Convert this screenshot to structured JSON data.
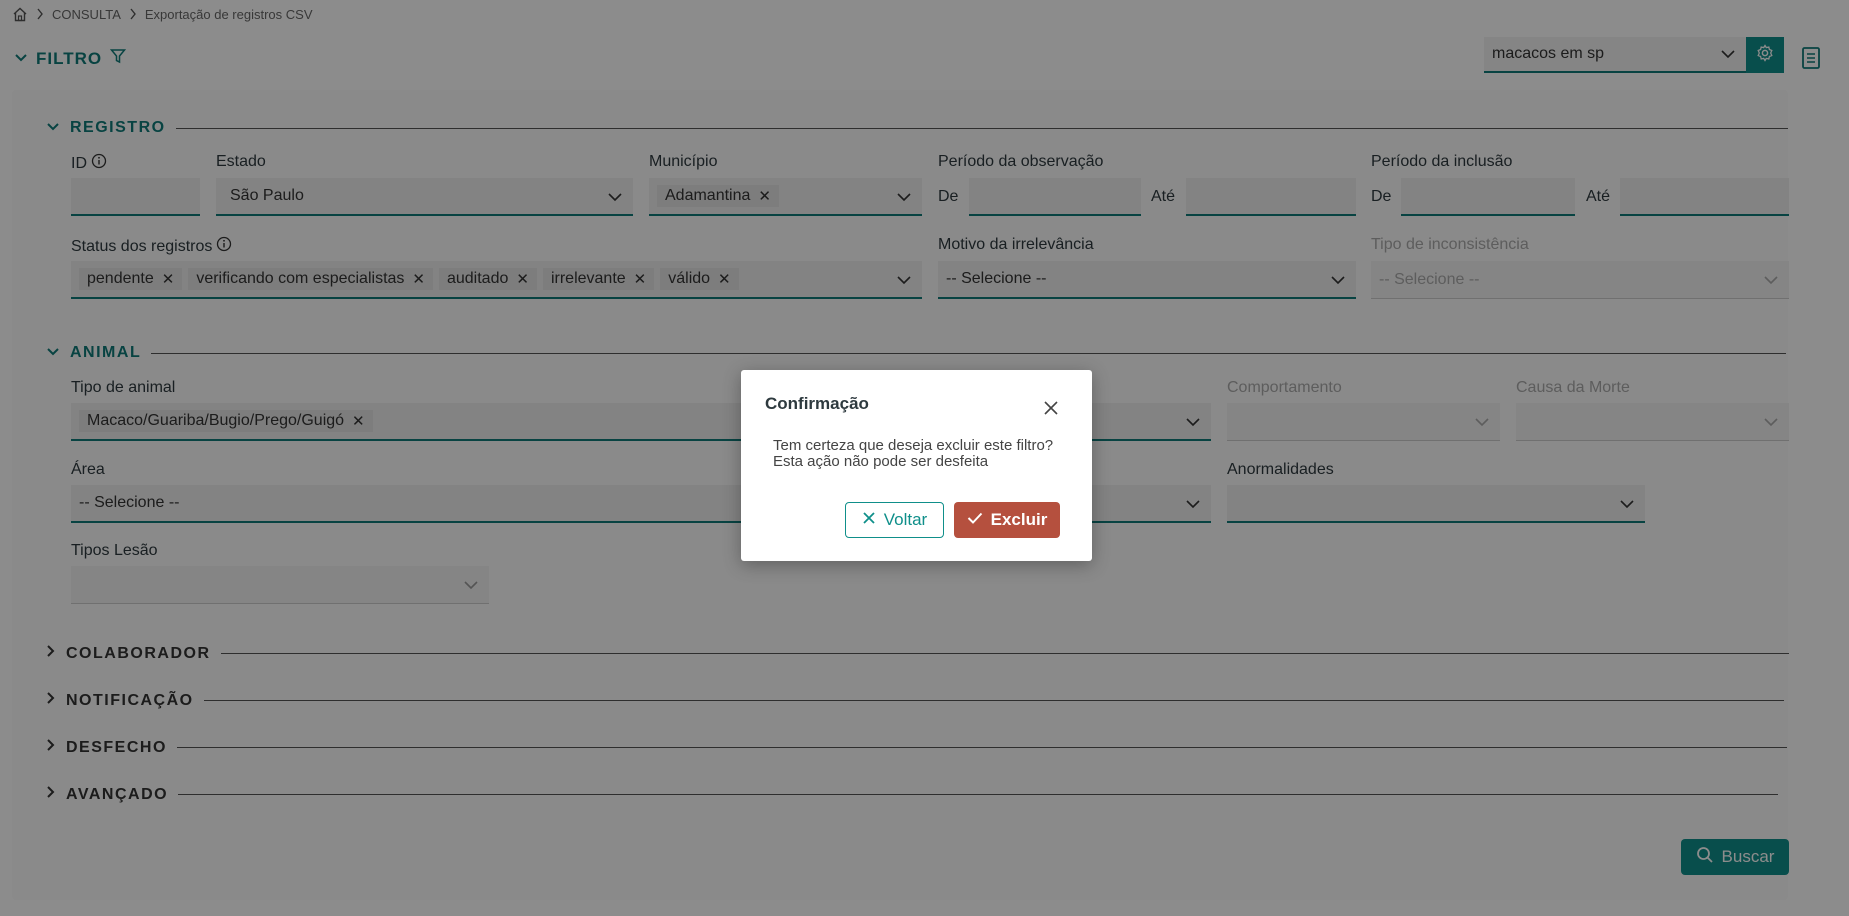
{
  "breadcrumb": {
    "items": [
      "CONSULTA",
      "Exportação de registros CSV"
    ]
  },
  "filter": {
    "title": "FILTRO"
  },
  "saved_filter": {
    "value": "macacos em sp"
  },
  "sections": {
    "registro": "REGISTRO",
    "animal": "ANIMAL",
    "colaborador": "COLABORADOR",
    "notificacao": "NOTIFICAÇÃO",
    "desfecho": "DESFECHO",
    "avancado": "AVANÇADO"
  },
  "registro": {
    "id_label": "ID",
    "estado_label": "Estado",
    "estado_value": "São Paulo",
    "municipio_label": "Município",
    "municipio_chip": "Adamantina",
    "obs_label": "Período da observação",
    "incl_label": "Período da inclusão",
    "de": "De",
    "ate": "Até",
    "status_label": "Status dos registros",
    "status_chips": [
      "pendente",
      "verificando com especialistas",
      "auditado",
      "irrelevante",
      "válido"
    ],
    "motivo_label": "Motivo da irrelevância",
    "motivo_value": "-- Selecione --",
    "tipo_incons_label": "Tipo de inconsistência",
    "tipo_incons_value": "-- Selecione --"
  },
  "animal": {
    "tipo_label": "Tipo de animal",
    "tipo_chip": "Macaco/Guariba/Bugio/Prego/Guigó",
    "comportamento_label": "Comportamento",
    "causa_label": "Causa da Morte",
    "area_label": "Área",
    "area_value": "-- Selecione --",
    "anormalidades_label": "Anormalidades",
    "lesao_label": "Tipos Lesão"
  },
  "search_button": "Buscar",
  "modal": {
    "title": "Confirmação",
    "message": "Tem certeza que deseja excluir este filtro? Esta ação não pode ser desfeita",
    "back_label": "Voltar",
    "delete_label": "Excluir"
  }
}
